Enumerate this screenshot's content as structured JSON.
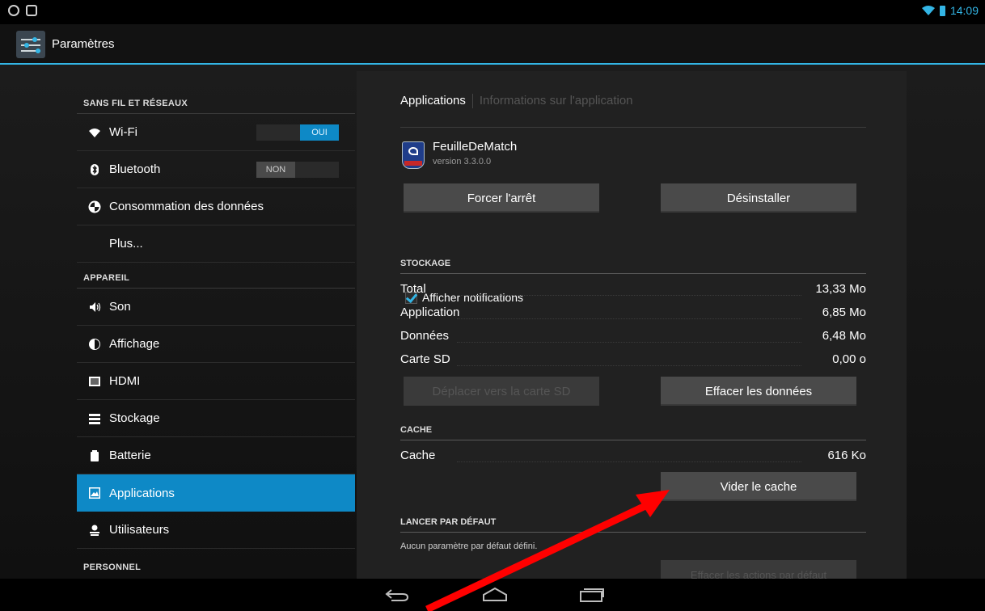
{
  "statusbar": {
    "time": "14:09"
  },
  "actionbar": {
    "title": "Paramètres"
  },
  "sidebar": {
    "sections": [
      {
        "label": "SANS FIL ET RÉSEAUX"
      },
      {
        "label": "APPAREIL"
      },
      {
        "label": "PERSONNEL"
      }
    ],
    "items": [
      {
        "label": "Wi-Fi",
        "icon": "wifi-icon"
      },
      {
        "label": "Bluetooth",
        "icon": "bluetooth-icon"
      },
      {
        "label": "Consommation des données",
        "icon": "data-usage-icon"
      },
      {
        "label": "Plus...",
        "icon": ""
      },
      {
        "label": "Son",
        "icon": "volume-icon"
      },
      {
        "label": "Affichage",
        "icon": "brightness-icon"
      },
      {
        "label": "HDMI",
        "icon": "hdmi-icon"
      },
      {
        "label": "Stockage",
        "icon": "storage-icon"
      },
      {
        "label": "Batterie",
        "icon": "battery-icon"
      },
      {
        "label": "Applications",
        "icon": "apps-icon",
        "active": true
      },
      {
        "label": "Utilisateurs",
        "icon": "users-icon"
      }
    ],
    "wifi_toggle": "OUI",
    "bluetooth_toggle": "NON"
  },
  "detail": {
    "tabs": {
      "active": "Applications",
      "inactive": "Informations sur l'application"
    },
    "app": {
      "name": "FeuilleDeMatch",
      "version": "version 3.3.0.0"
    },
    "buttons": {
      "force_stop": "Forcer l'arrêt",
      "uninstall": "Désinstaller",
      "move_sd": "Déplacer vers la carte SD",
      "clear_data": "Effacer les données",
      "clear_cache": "Vider le cache",
      "clear_defaults": "Effacer les actions par défaut"
    },
    "show_notifications": "Afficher notifications",
    "storage": {
      "header": "STOCKAGE",
      "rows": [
        {
          "label": "Total",
          "value": "13,33 Mo"
        },
        {
          "label": "Application",
          "value": "6,85 Mo"
        },
        {
          "label": "Données",
          "value": "6,48 Mo"
        },
        {
          "label": "Carte SD",
          "value": "0,00 o"
        }
      ]
    },
    "cache": {
      "header": "CACHE",
      "label": "Cache",
      "value": "616 Ko"
    },
    "launch_default": {
      "header": "LANCER PAR DÉFAUT",
      "text": "Aucun paramètre par défaut défini."
    }
  },
  "colors": {
    "accent": "#33b5e5",
    "selected": "#0e89c6",
    "annotation_arrow": "#ff0000"
  }
}
